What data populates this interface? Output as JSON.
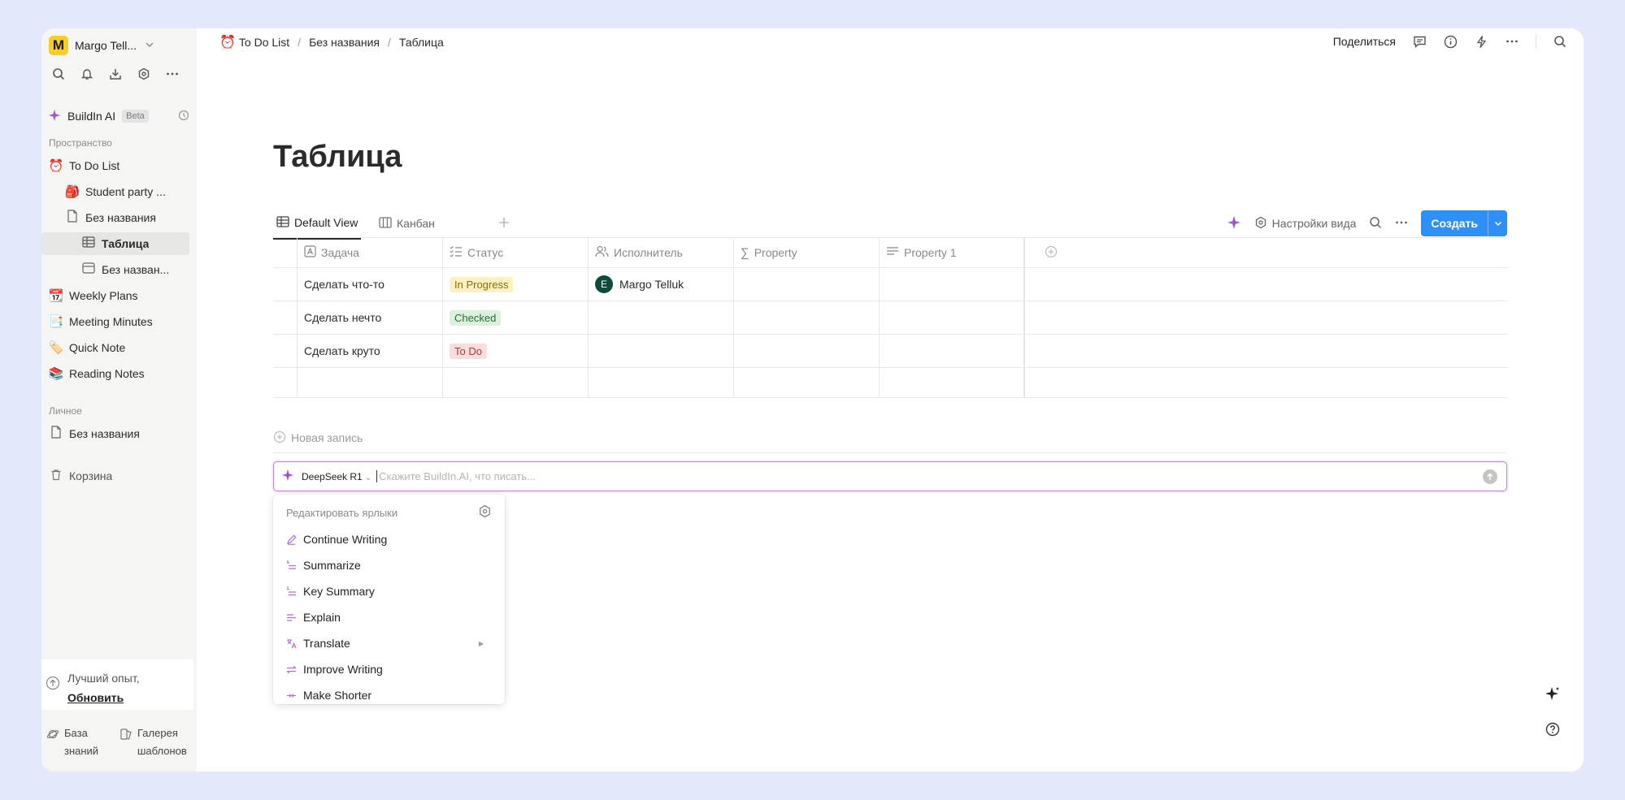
{
  "workspace": {
    "logo": "M",
    "name": "Margo Tell..."
  },
  "sidebar": {
    "ai": {
      "label": "BuildIn AI",
      "badge": "Beta"
    },
    "space_label": "Пространство",
    "items": [
      {
        "icon": "⏰",
        "label": "To Do List"
      },
      {
        "icon": "🎒",
        "label": "Student party ..."
      },
      {
        "icon": "page",
        "label": "Без названия"
      },
      {
        "icon": "table",
        "label": "Таблица"
      },
      {
        "icon": "board",
        "label": "Без назван..."
      },
      {
        "icon": "📆",
        "label": "Weekly Plans"
      },
      {
        "icon": "📑",
        "label": "Meeting Minutes"
      },
      {
        "icon": "🏷️",
        "label": "Quick Note"
      },
      {
        "icon": "📚",
        "label": "Reading Notes"
      }
    ],
    "personal_label": "Личное",
    "personal_items": [
      {
        "icon": "page",
        "label": "Без названия"
      }
    ],
    "trash": "Корзина",
    "upgrade": {
      "text": "Лучший опыт,",
      "link": "Обновить"
    },
    "bottom": [
      {
        "line1": "База",
        "line2": "знаний"
      },
      {
        "line1": "Галерея",
        "line2": "шаблонов"
      }
    ]
  },
  "topbar": {
    "breadcrumbs": [
      "To Do List",
      "Без названия",
      "Таблица"
    ],
    "breadcrumb_icon": "⏰",
    "share": "Поделиться"
  },
  "page": {
    "title": "Таблица"
  },
  "views": {
    "tabs": [
      "Default View",
      "Канбан"
    ],
    "settings": "Настройки вида",
    "create": "Создать"
  },
  "table": {
    "columns": [
      "Задача",
      "Статус",
      "Исполнитель",
      "Property",
      "Property 1"
    ],
    "rows": [
      {
        "task": "Сделать что-то",
        "status": "In Progress",
        "status_bg": "#fdf1c4",
        "status_fg": "#8a6a12",
        "assignee": "Margo Telluk",
        "avatar": "E"
      },
      {
        "task": "Сделать нечто",
        "status": "Checked",
        "status_bg": "#dcf0de",
        "status_fg": "#2f6b35",
        "assignee": "",
        "avatar": ""
      },
      {
        "task": "Сделать круто",
        "status": "To Do",
        "status_bg": "#fbdcdc",
        "status_fg": "#a33b3b",
        "assignee": "",
        "avatar": ""
      }
    ],
    "new_row": "Новая запись"
  },
  "ai_input": {
    "model": "DeepSeek R1",
    "placeholder": "Скажите BuildIn.AI, что писать..."
  },
  "ai_menu": {
    "header": "Редактировать ярлыки",
    "items": [
      {
        "label": "Continue Writing",
        "icon": "pen-icon"
      },
      {
        "label": "Summarize",
        "icon": "summary-icon"
      },
      {
        "label": "Key Summary",
        "icon": "key-summary-icon"
      },
      {
        "label": "Explain",
        "icon": "explain-icon"
      },
      {
        "label": "Translate",
        "icon": "translate-icon",
        "submenu": true
      },
      {
        "label": "Improve Writing",
        "icon": "improve-icon"
      },
      {
        "label": "Make Shorter",
        "icon": "shorter-icon"
      }
    ]
  },
  "colors": {
    "accent": "#2f8ff5",
    "ai": "#b06cd0",
    "sidebar_bg": "#f5f5f4"
  }
}
